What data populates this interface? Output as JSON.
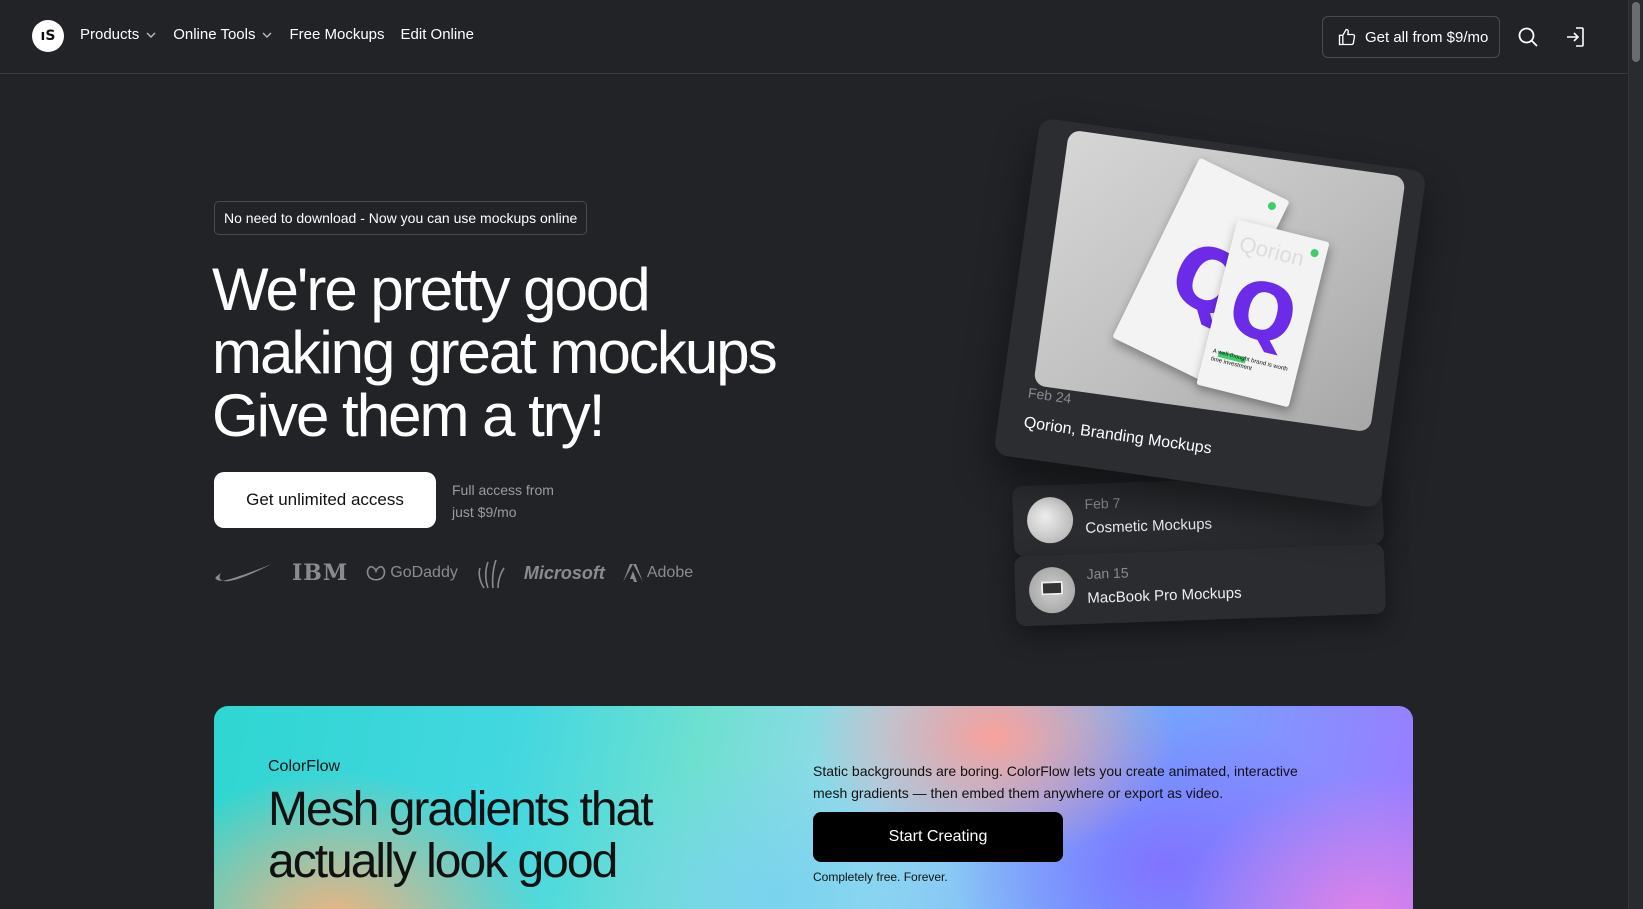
{
  "nav": {
    "items": [
      {
        "label": "Products",
        "has_dropdown": true
      },
      {
        "label": "Online Tools",
        "has_dropdown": true
      },
      {
        "label": "Free Mockups",
        "has_dropdown": false
      },
      {
        "label": "Edit Online",
        "has_dropdown": false
      }
    ],
    "cta_label": "Get all from $9/mo"
  },
  "hero": {
    "badge": "No need to download - Now you can use mockups online",
    "headline_lines": [
      "We're pretty good",
      "making great mockups",
      "Give them a try!"
    ],
    "primary_button": "Get unlimited access",
    "access_note_line1": "Full access from",
    "access_note_line2": "just $9/mo",
    "brands": [
      "IBM",
      "GoDaddy",
      "Microsoft",
      "Adobe"
    ]
  },
  "cards": {
    "featured": {
      "date": "Feb 24",
      "title": "Qorion, Branding Mockups",
      "book_word": "Qorion",
      "book_letter": "Q",
      "book_tagline": "A well-thought brand is worth time investment"
    },
    "list": [
      {
        "date": "Feb 7",
        "title": "Cosmetic Mockups"
      },
      {
        "date": "Jan 15",
        "title": "MacBook Pro Mockups"
      }
    ]
  },
  "banner": {
    "kicker": "ColorFlow",
    "title": "Mesh gradients that actually look good",
    "description": "Static backgrounds are boring. ColorFlow lets you create animated, interactive mesh gradients — then embed them anywhere or export as video.",
    "button": "Start Creating",
    "note": "Completely free. Forever."
  },
  "colors": {
    "background": "#222327",
    "accent_purple": "#6b2be8",
    "accent_green": "#3ccf6b"
  }
}
